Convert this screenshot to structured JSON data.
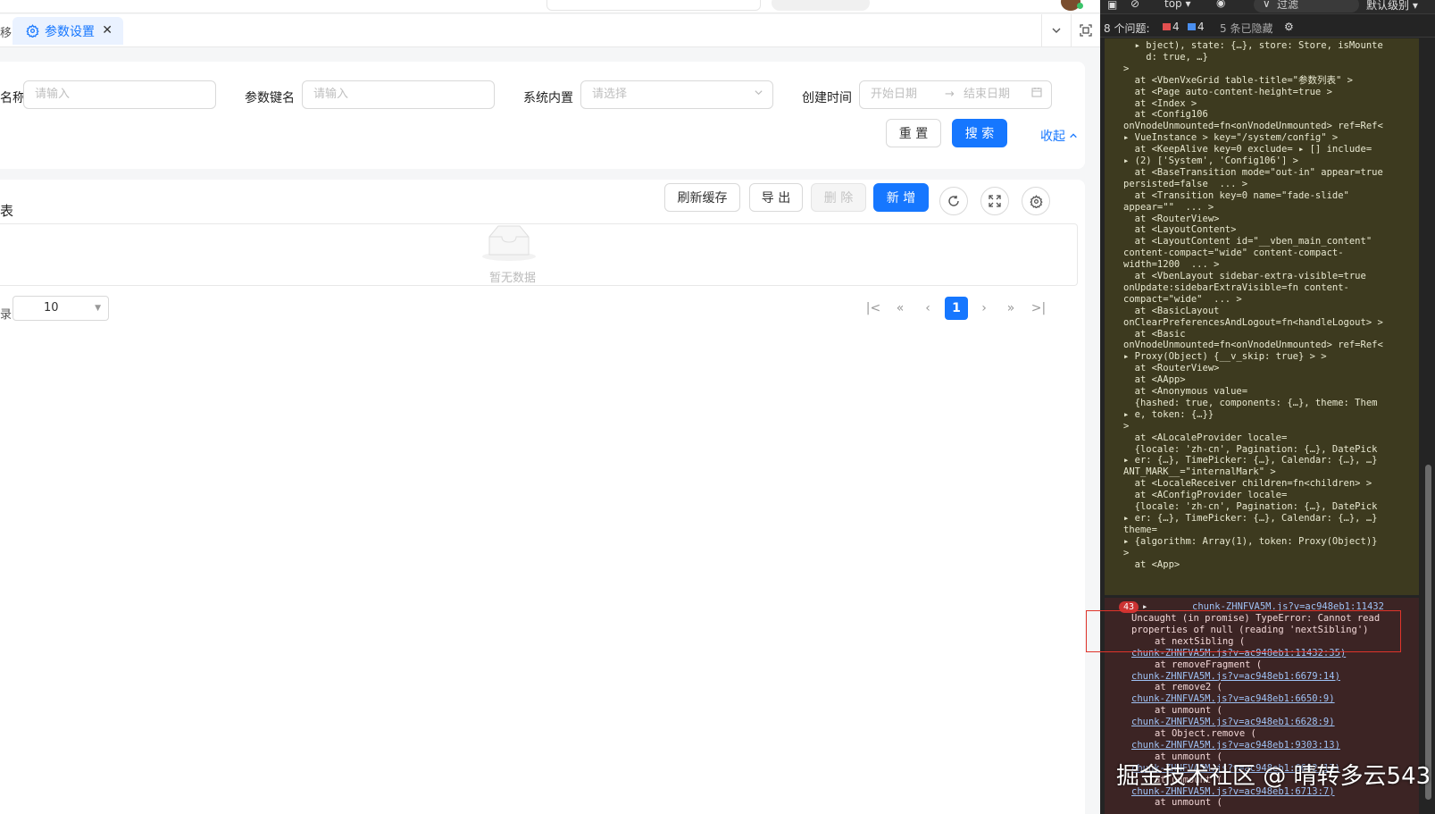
{
  "tabs": {
    "prev_label": "移",
    "active_label": "参数设置",
    "close_glyph": "✕"
  },
  "search_form": {
    "name_label": "名称",
    "name_placeholder": "请输入",
    "key_label": "参数键名",
    "key_placeholder": "请输入",
    "builtin_label": "系统内置",
    "builtin_placeholder": "请选择",
    "created_label": "创建时间",
    "start_placeholder": "开始日期",
    "range_sep": "→",
    "end_placeholder": "结束日期",
    "reset_label": "重 置",
    "search_label": "搜 索",
    "collapse_label": "收起"
  },
  "grid": {
    "title": "表",
    "refresh_cache_label": "刷新缓存",
    "export_label": "导 出",
    "delete_label": "删 除",
    "add_label": "新 增",
    "empty_text": "暂无数据"
  },
  "pagination": {
    "left_label": "录",
    "page_size": "10",
    "current_page": "1"
  },
  "devtools": {
    "context": "top ▾",
    "filter_label": "过滤",
    "level_label": "默认级别 ▾",
    "issues_label": "8 个问题:",
    "error_count": "4",
    "info_count": "4",
    "hidden_label": "5 条已隐藏",
    "warn_lines": [
      "  ▸ bject), state: {…}, store: Store, isMounte",
      "    d: true, …}",
      ">",
      "  at <VbenVxeGrid table-title=\"参数列表\" >",
      "  at <Page auto-content-height=true >",
      "  at <Index >",
      "  at <Config106",
      "onVnodeUnmounted=fn<onVnodeUnmounted> ref=Ref<",
      "▸ VueInstance > key=\"/system/config\" >",
      "  at <KeepAlive key=0 exclude= ▸ [] include=",
      "▸ (2) ['System', 'Config106'] >",
      "  at <BaseTransition mode=\"out-in\" appear=true",
      "persisted=false  ... >",
      "  at <Transition key=0 name=\"fade-slide\"",
      "appear=\"\"  ... >",
      "  at <RouterView>",
      "  at <LayoutContent>",
      "  at <LayoutContent id=\"__vben_main_content\"",
      "content-compact=\"wide\" content-compact-",
      "width=1200  ... >",
      "  at <VbenLayout sidebar-extra-visible=true",
      "onUpdate:sidebarExtraVisible=fn content-",
      "compact=\"wide\"  ... >",
      "  at <BasicLayout",
      "onClearPreferencesAndLogout=fn<handleLogout> >",
      "  at <Basic",
      "onVnodeUnmounted=fn<onVnodeUnmounted> ref=Ref<",
      "▸ Proxy(Object) {__v_skip: true} > >",
      "  at <RouterView>",
      "  at <AApp>",
      "  at <Anonymous value=",
      "  {hashed: true, components: {…}, theme: Them",
      "▸ e, token: {…}}",
      ">",
      "  at <ALocaleProvider locale=",
      "  {locale: 'zh-cn', Pagination: {…}, DatePick",
      "▸ er: {…}, TimePicker: {…}, Calendar: {…}, …}",
      "ANT_MARK__=\"internalMark\" >",
      "  at <LocaleReceiver children=fn<children> >",
      "  at <AConfigProvider locale=",
      "  {locale: 'zh-cn', Pagination: {…}, DatePick",
      "▸ er: {…}, TimePicker: {…}, Calendar: {…}, …}",
      "theme=",
      "▸ {algorithm: Array(1), token: Proxy(Object)}",
      ">",
      "  at <App>"
    ],
    "err_badge": "43",
    "err_source": "chunk-ZHNFVA5M.js?v=ac948eb1:11432",
    "err_lines": [
      {
        "text": "Uncaught (in promise) TypeError: Cannot read",
        "link": false,
        "indent": 0
      },
      {
        "text": "properties of null (reading 'nextSibling')",
        "link": false,
        "indent": 0
      },
      {
        "text": "at nextSibling (",
        "link": false,
        "indent": 1
      },
      {
        "text": "chunk-ZHNFVA5M.js?v=ac948eb1:11432:35)",
        "link": true,
        "indent": 0
      },
      {
        "text": "at removeFragment (",
        "link": false,
        "indent": 1
      },
      {
        "text": "chunk-ZHNFVA5M.js?v=ac948eb1:6679:14)",
        "link": true,
        "indent": 0
      },
      {
        "text": "at remove2 (",
        "link": false,
        "indent": 1
      },
      {
        "text": "chunk-ZHNFVA5M.js?v=ac948eb1:6650:9)",
        "link": true,
        "indent": 0
      },
      {
        "text": "at unmount (",
        "link": false,
        "indent": 1
      },
      {
        "text": "chunk-ZHNFVA5M.js?v=ac948eb1:6628:9)",
        "link": true,
        "indent": 0
      },
      {
        "text": "at Object.remove (",
        "link": false,
        "indent": 1
      },
      {
        "text": "chunk-ZHNFVA5M.js?v=ac948eb1:9303:13)",
        "link": true,
        "indent": 0
      },
      {
        "text": "at unmount (",
        "link": false,
        "indent": 1
      },
      {
        "text": "chunk-ZHNFVA5M.js?v=ac948eb1:6602:13)",
        "link": true,
        "indent": 0
      },
      {
        "text": "at unmount (",
        "link": false,
        "indent": 1
      },
      {
        "text": "chunk-ZHNFVA5M.js?v=ac948eb1:6713:7)",
        "link": true,
        "indent": 0
      },
      {
        "text": "at unmount (",
        "link": false,
        "indent": 1
      }
    ]
  },
  "watermark": "掘金技术社区 @ 晴转多云543",
  "colors": {
    "accent": "#1677ff",
    "error_highlight": "#e0342b"
  }
}
